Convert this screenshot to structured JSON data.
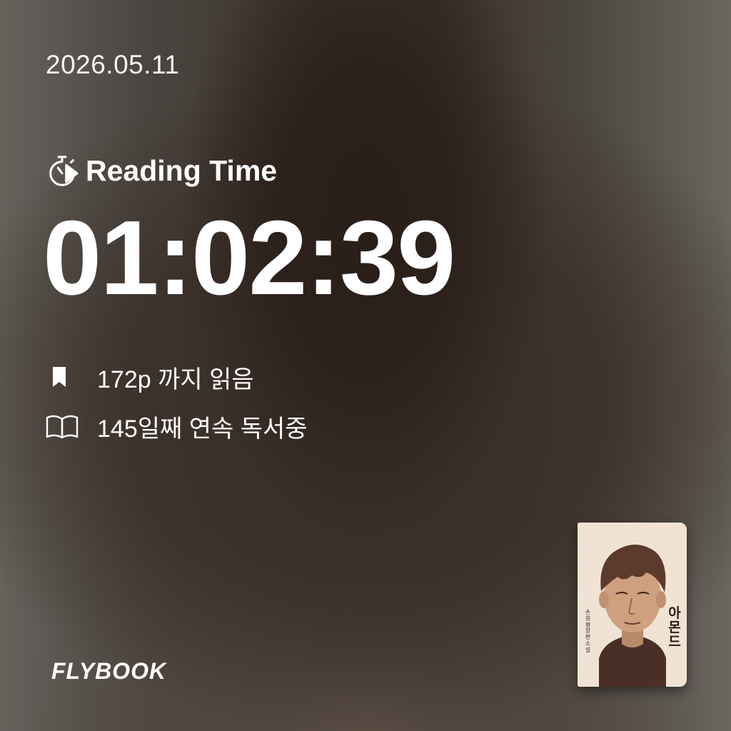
{
  "date": "2026.05.11",
  "reading": {
    "label": "Reading Time",
    "icon": "stopwatch-play-icon",
    "timer": "01:02:39"
  },
  "stats": [
    {
      "icon": "bookmark-icon",
      "text": "172p 까지 읽음"
    },
    {
      "icon": "open-book-icon",
      "text": "145일째 연속 독서중"
    }
  ],
  "brand": "FLYBOOK",
  "book": {
    "title": "아몬드",
    "author": "손원평 장편소설"
  },
  "colors": {
    "text": "#ffffff",
    "background_center": "#3b322c",
    "background_edges": "#66625c",
    "cover_background": "#f1e3d4"
  }
}
